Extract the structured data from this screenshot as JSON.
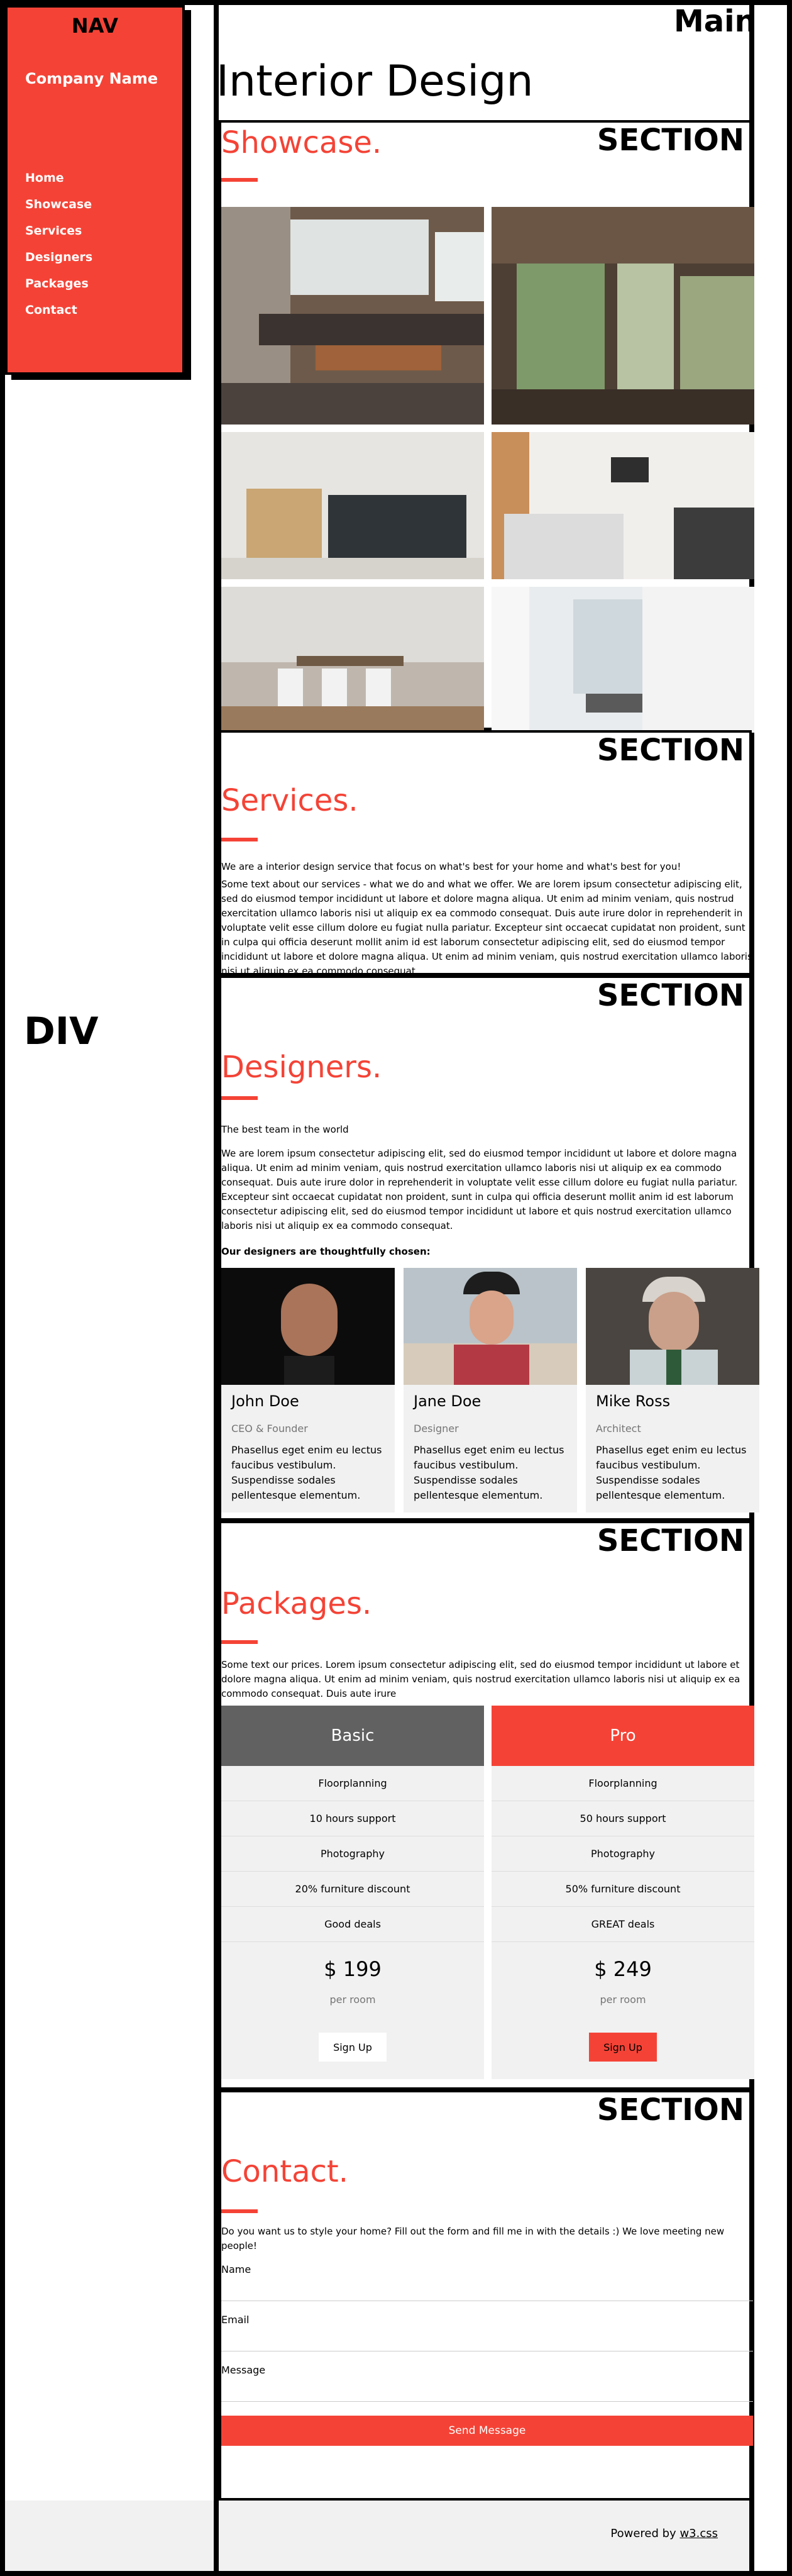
{
  "labels": {
    "nav": "NAV",
    "div": "DIV",
    "main": "Main",
    "section": "SECTION"
  },
  "sidebar": {
    "company": "Company Name",
    "items": [
      {
        "label": "Home"
      },
      {
        "label": "Showcase"
      },
      {
        "label": "Services"
      },
      {
        "label": "Designers"
      },
      {
        "label": "Packages"
      },
      {
        "label": "Contact"
      }
    ]
  },
  "page": {
    "title": "Interior Design"
  },
  "showcase": {
    "title": "Showcase."
  },
  "services": {
    "title": "Services.",
    "intro": "We are a interior design service that focus on what's best for your home and what's best for you!",
    "body": "Some text about our services - what we do and what we offer. We are lorem ipsum consectetur adipiscing elit, sed do eiusmod tempor incididunt ut labore et dolore magna aliqua. Ut enim ad minim veniam, quis nostrud exercitation ullamco laboris nisi ut aliquip ex ea commodo consequat. Duis aute irure dolor in reprehenderit in voluptate velit esse cillum dolore eu fugiat nulla pariatur. Excepteur sint occaecat cupidatat non proident, sunt in culpa qui officia deserunt mollit anim id est laborum consectetur adipiscing elit, sed do eiusmod tempor incididunt ut labore et dolore magna aliqua. Ut enim ad minim veniam, quis nostrud exercitation ullamco laboris nisi ut aliquip ex ea commodo consequat."
  },
  "designers": {
    "title": "Designers.",
    "tagline": "The best team in the world",
    "body": "We are lorem ipsum consectetur adipiscing elit, sed do eiusmod tempor incididunt ut labore et dolore magna aliqua. Ut enim ad minim veniam, quis nostrud exercitation ullamco laboris nisi ut aliquip ex ea commodo consequat. Duis aute irure dolor in reprehenderit in voluptate velit esse cillum dolore eu fugiat nulla pariatur. Excepteur sint occaecat cupidatat non proident, sunt in culpa qui officia deserunt mollit anim id est laborum consectetur adipiscing elit, sed do eiusmod tempor incididunt ut labore et quis nostrud exercitation ullamco laboris nisi ut aliquip ex ea commodo consequat.",
    "chosen": "Our designers are thoughtfully chosen:",
    "people": [
      {
        "name": "John Doe",
        "role": "CEO & Founder",
        "bio": "Phasellus eget enim eu lectus faucibus vestibulum. Suspendisse sodales pellentesque elementum."
      },
      {
        "name": "Jane Doe",
        "role": "Designer",
        "bio": "Phasellus eget enim eu lectus faucibus vestibulum. Suspendisse sodales pellentesque elementum."
      },
      {
        "name": "Mike Ross",
        "role": "Architect",
        "bio": "Phasellus eget enim eu lectus faucibus vestibulum. Suspendisse sodales pellentesque elementum."
      }
    ]
  },
  "packages": {
    "title": "Packages.",
    "intro": "Some text our prices. Lorem ipsum consectetur adipiscing elit, sed do eiusmod tempor incididunt ut labore et dolore magna aliqua. Ut enim ad minim veniam, quis nostrud exercitation ullamco laboris nisi ut aliquip ex ea commodo consequat. Duis aute irure",
    "plans": [
      {
        "name": "Basic",
        "features": [
          "Floorplanning",
          "10 hours support",
          "Photography",
          "20% furniture discount",
          "Good deals"
        ],
        "price": "$ 199",
        "per": "per room",
        "button": "Sign Up"
      },
      {
        "name": "Pro",
        "features": [
          "Floorplanning",
          "50 hours support",
          "Photography",
          "50% furniture discount",
          "GREAT deals"
        ],
        "price": "$ 249",
        "per": "per room",
        "button": "Sign Up"
      }
    ]
  },
  "contact": {
    "title": "Contact.",
    "intro": "Do you want us to style your home? Fill out the form and fill me in with the details :) We love meeting new people!",
    "fields": [
      {
        "label": "Name",
        "value": ""
      },
      {
        "label": "Email",
        "value": ""
      },
      {
        "label": "Message",
        "value": ""
      }
    ],
    "button": "Send Message"
  },
  "footer": {
    "prefix": "Powered by ",
    "link": "w3.css"
  },
  "colors": {
    "accent": "#f44336",
    "basic_header": "#616161",
    "panel": "#f1f1f1",
    "frame": "#000000"
  }
}
